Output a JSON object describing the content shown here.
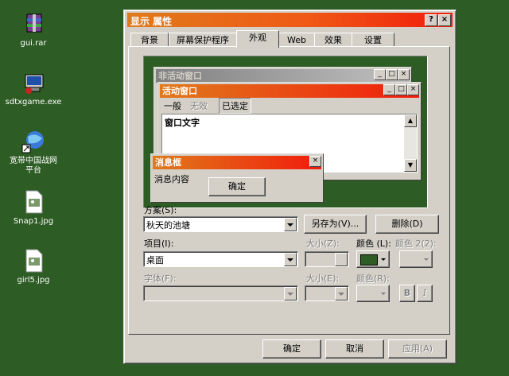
{
  "desktop": {
    "icons": [
      {
        "label": "gui.rar"
      },
      {
        "label": "sdtxgame.exe"
      },
      {
        "label": "宽带中国战网平台"
      },
      {
        "label": "Snap1.jpg"
      },
      {
        "label": "girl5.jpg"
      }
    ]
  },
  "window": {
    "title": "显示 属性",
    "help_btn": "?",
    "close_btn": "×"
  },
  "tabs": [
    "背景",
    "屏幕保护程序",
    "外观",
    "Web",
    "效果",
    "设置"
  ],
  "active_tab": "外观",
  "preview": {
    "inactive_title": "非活动窗口",
    "active_title": "活动窗口",
    "menu": [
      "一般",
      "无效",
      "已选定"
    ],
    "window_text": "窗口文字",
    "msgbox_title": "消息框",
    "msgbox_text": "消息内容",
    "msgbox_ok": "确定"
  },
  "scheme": {
    "label": "方案(S):",
    "value": "秋天的池塘",
    "save_as": "另存为(V)...",
    "delete": "删除(D)"
  },
  "item": {
    "label": "项目(I):",
    "value": "桌面",
    "size_label": "大小(Z):",
    "color_label": "颜色 (L):",
    "color2_label": "颜色 2(2):",
    "color_value": "#2d5c24"
  },
  "font": {
    "label": "字体(F):",
    "size_label": "大小(E):",
    "color_label": "颜色(R):",
    "bold": "B",
    "italic": "I"
  },
  "buttons": {
    "ok": "确定",
    "cancel": "取消",
    "apply": "应用(A)"
  }
}
